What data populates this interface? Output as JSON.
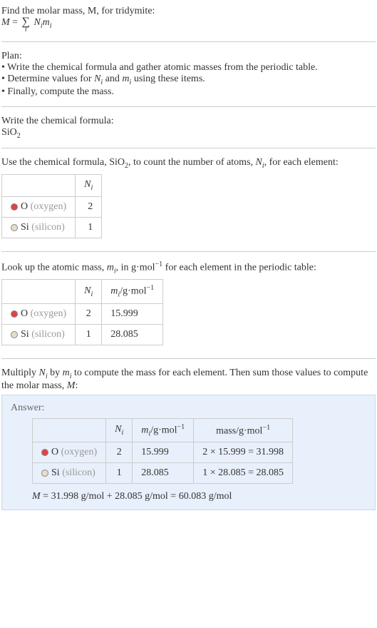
{
  "intro": {
    "line1": "Find the molar mass, M, for tridymite:",
    "line2_lhs": "M",
    "line2_eq": "=",
    "line2_sigma": "∑",
    "line2_sub": "i",
    "line2_rhs1": "N",
    "line2_rhs1_sub": "i",
    "line2_rhs2": "m",
    "line2_rhs2_sub": "i"
  },
  "plan": {
    "title": "Plan:",
    "b1": "• Write the chemical formula and gather atomic masses from the periodic table.",
    "b2_a": "• Determine values for ",
    "b2_N": "N",
    "b2_N_sub": "i",
    "b2_and": " and ",
    "b2_m": "m",
    "b2_m_sub": "i",
    "b2_end": " using these items.",
    "b3": "• Finally, compute the mass."
  },
  "chemformula": {
    "title": "Write the chemical formula:",
    "formula_base": "SiO",
    "formula_sub": "2"
  },
  "count": {
    "text_a": "Use the chemical formula, SiO",
    "text_sub": "2",
    "text_b": ", to count the number of atoms, ",
    "text_N": "N",
    "text_N_sub": "i",
    "text_c": ", for each element:",
    "header_N": "N",
    "header_N_sub": "i",
    "rows": [
      {
        "swatch": "red",
        "sym": "O",
        "name": "(oxygen)",
        "n": "2"
      },
      {
        "swatch": "tan",
        "sym": "Si",
        "name": "(silicon)",
        "n": "1"
      }
    ]
  },
  "lookup": {
    "text_a": "Look up the atomic mass, ",
    "text_m": "m",
    "text_m_sub": "i",
    "text_b": ", in g·mol",
    "text_sup": "−1",
    "text_c": " for each element in the periodic table:",
    "header_N": "N",
    "header_N_sub": "i",
    "header_m": "m",
    "header_m_sub": "i",
    "header_m_unit": "/g·mol",
    "header_m_sup": "−1",
    "rows": [
      {
        "swatch": "red",
        "sym": "O",
        "name": "(oxygen)",
        "n": "2",
        "m": "15.999"
      },
      {
        "swatch": "tan",
        "sym": "Si",
        "name": "(silicon)",
        "n": "1",
        "m": "28.085"
      }
    ]
  },
  "multiply": {
    "text_a": "Multiply ",
    "text_N": "N",
    "text_N_sub": "i",
    "text_by": " by ",
    "text_m": "m",
    "text_m_sub": "i",
    "text_b": " to compute the mass for each element. Then sum those values to compute the molar mass, ",
    "text_M": "M",
    "text_c": ":"
  },
  "answer": {
    "label": "Answer:",
    "header_N": "N",
    "header_N_sub": "i",
    "header_m": "m",
    "header_m_sub": "i",
    "header_m_unit": "/g·mol",
    "header_m_sup": "−1",
    "header_mass": "mass/g·mol",
    "header_mass_sup": "−1",
    "rows": [
      {
        "swatch": "red",
        "sym": "O",
        "name": "(oxygen)",
        "n": "2",
        "m": "15.999",
        "mass": "2 × 15.999 = 31.998"
      },
      {
        "swatch": "tan",
        "sym": "Si",
        "name": "(silicon)",
        "n": "1",
        "m": "28.085",
        "mass": "1 × 28.085 = 28.085"
      }
    ],
    "result_M": "M",
    "result_text": " = 31.998 g/mol + 28.085 g/mol = 60.083 g/mol"
  }
}
